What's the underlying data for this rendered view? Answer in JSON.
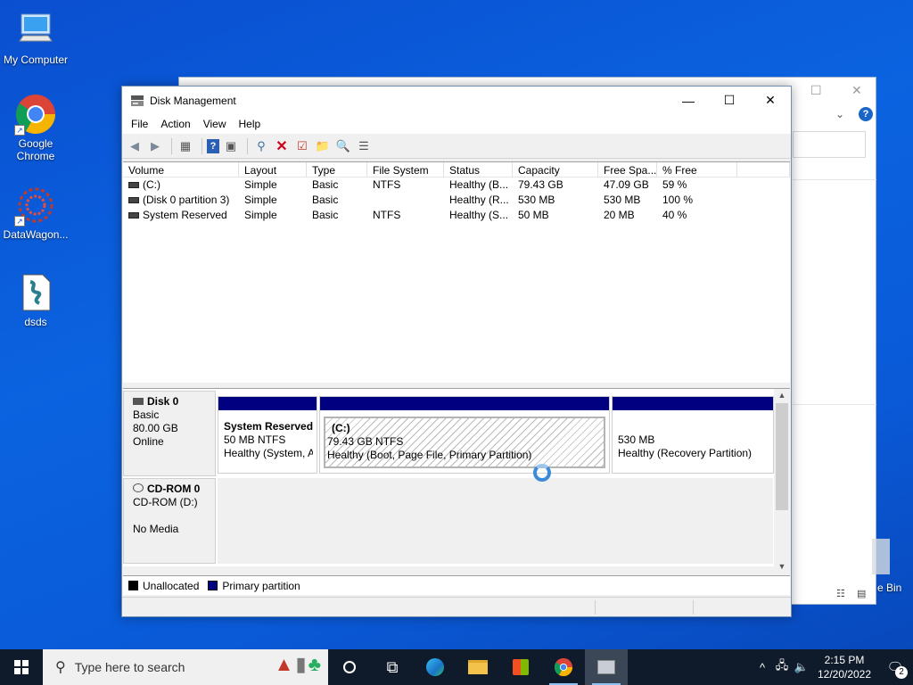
{
  "desktop": {
    "icons": [
      {
        "label": "My Computer"
      },
      {
        "label": "Google Chrome"
      },
      {
        "label": "DataWagon..."
      },
      {
        "label": "dsds"
      }
    ],
    "recycle_label": "e Bin"
  },
  "window": {
    "title": "Disk Management",
    "controls": {
      "minimize": "—",
      "maximize": "☐",
      "close": "✕"
    },
    "menu": [
      "File",
      "Action",
      "View",
      "Help"
    ],
    "columns": [
      "Volume",
      "Layout",
      "Type",
      "File System",
      "Status",
      "Capacity",
      "Free Spa...",
      "% Free",
      ""
    ],
    "volumes": [
      {
        "volume": "(C:)",
        "layout": "Simple",
        "type": "Basic",
        "fs": "NTFS",
        "status": "Healthy (B...",
        "capacity": "79.43 GB",
        "free": "47.09 GB",
        "pct": "59 %"
      },
      {
        "volume": "(Disk 0 partition 3)",
        "layout": "Simple",
        "type": "Basic",
        "fs": "",
        "status": "Healthy (R...",
        "capacity": "530 MB",
        "free": "530 MB",
        "pct": "100 %"
      },
      {
        "volume": "System Reserved",
        "layout": "Simple",
        "type": "Basic",
        "fs": "NTFS",
        "status": "Healthy (S...",
        "capacity": "50 MB",
        "free": "20 MB",
        "pct": "40 %"
      }
    ],
    "disks": [
      {
        "name": "Disk 0",
        "type": "Basic",
        "size": "80.00 GB",
        "state": "Online"
      },
      {
        "name": "CD-ROM 0",
        "type": "CD-ROM (D:)",
        "size": "",
        "state": "No Media"
      }
    ],
    "partitions": [
      {
        "name": "System Reserved",
        "line1": "50 MB NTFS",
        "line2": "Healthy (System, A"
      },
      {
        "name": "(C:)",
        "line1": "79.43 GB NTFS",
        "line2": "Healthy (Boot, Page File, Primary Partition)"
      },
      {
        "name": "",
        "line1": "530 MB",
        "line2": "Healthy (Recovery Partition)"
      }
    ],
    "legend": [
      {
        "label": "Unallocated",
        "color": "#000000"
      },
      {
        "label": "Primary partition",
        "color": "#000080"
      }
    ]
  },
  "taskbar": {
    "search_placeholder": "Type here to search",
    "time": "2:15 PM",
    "date": "12/20/2022",
    "notification_count": "2"
  }
}
